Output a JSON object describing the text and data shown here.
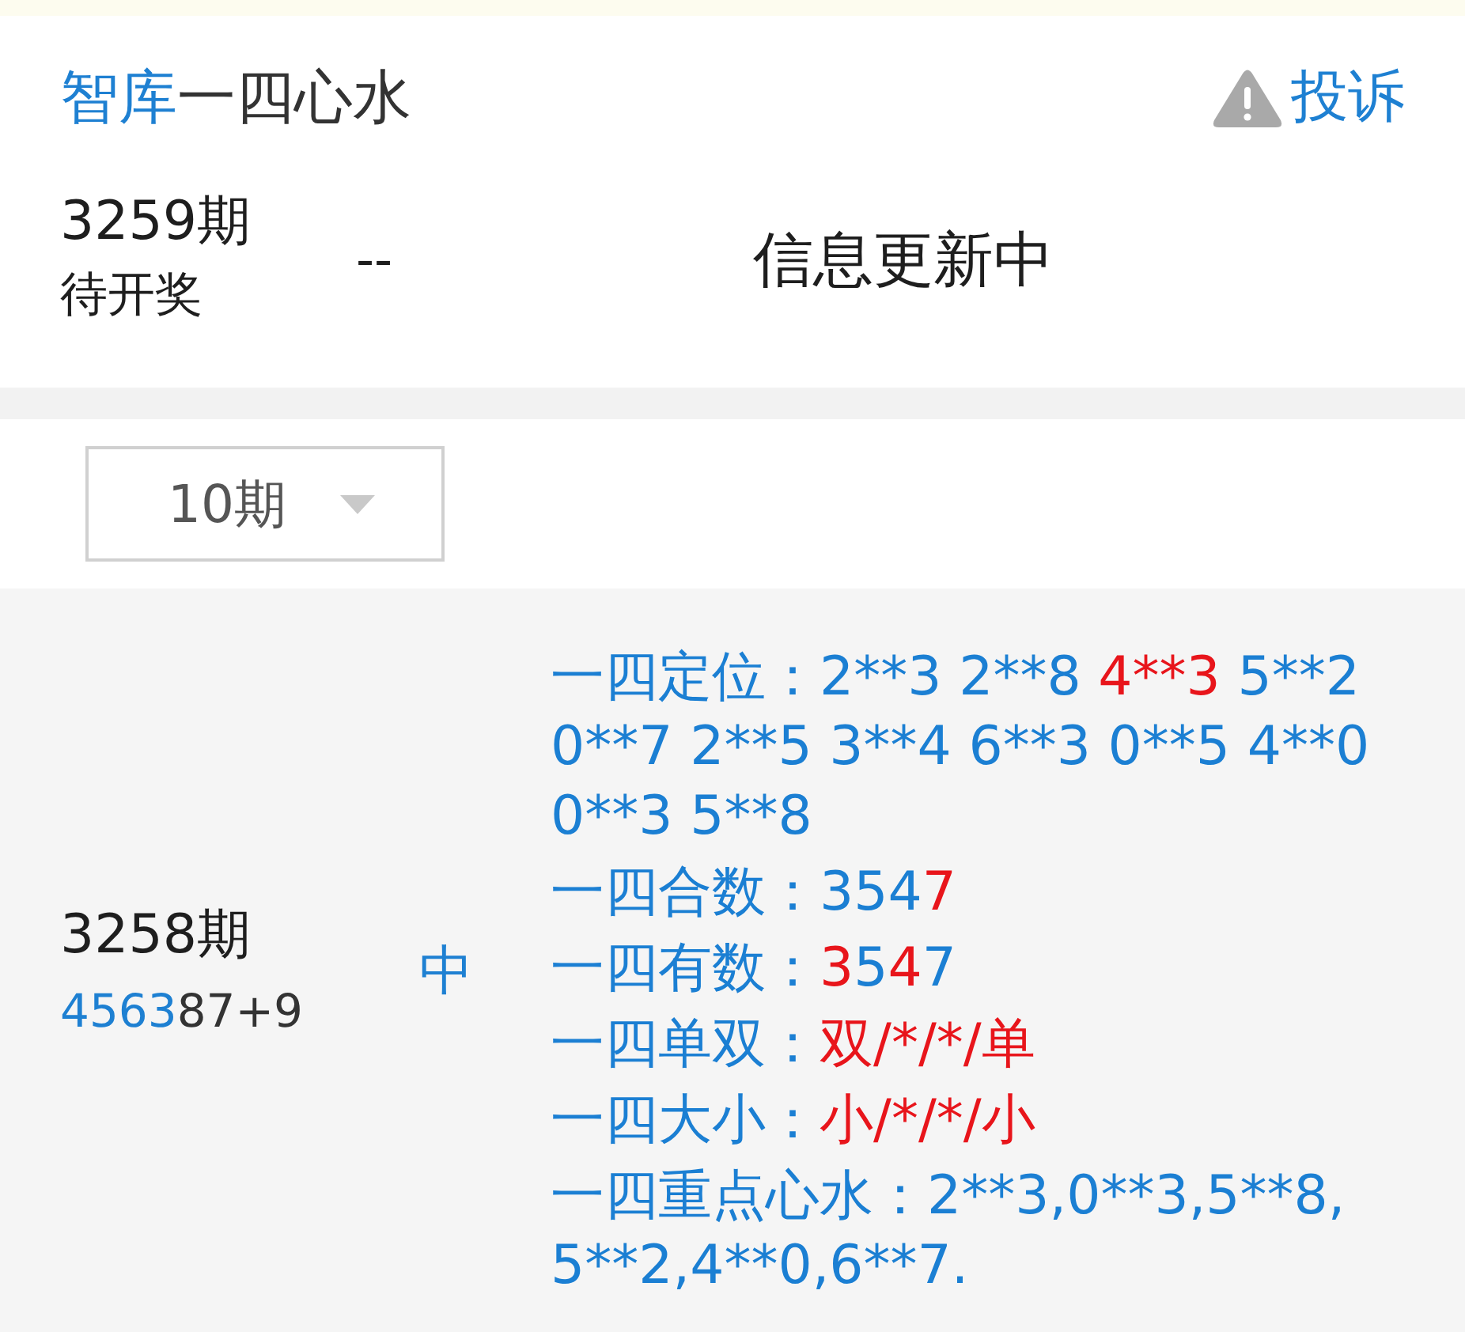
{
  "header": {
    "title": [
      {
        "text": "智库",
        "highlight": true
      },
      {
        "text": "一四心水",
        "highlight": false
      }
    ],
    "complaint": "投诉"
  },
  "current": {
    "period": "3259期",
    "status": "待开奖",
    "numbers": "--",
    "message": "信息更新中"
  },
  "filter": {
    "value": "10期"
  },
  "records": [
    {
      "period": "3258期",
      "result": [
        {
          "text": "4563",
          "highlight": true
        },
        {
          "text": "87+9",
          "highlight": false
        }
      ],
      "verdict": "中",
      "lines": [
        {
          "label": "一四定位：",
          "segments": [
            {
              "text": "2**3 2**8 ",
              "highlight": false
            },
            {
              "text": "4**3",
              "highlight": true
            },
            {
              "text": " 5**2 0**7 2**5 3**4 6**3 0**5 4**0 0**3 5**8",
              "highlight": false
            }
          ]
        },
        {
          "label": "一四合数：",
          "segments": [
            {
              "text": "354",
              "highlight": false
            },
            {
              "text": "7",
              "highlight": true
            }
          ]
        },
        {
          "label": "一四有数：",
          "segments": [
            {
              "text": "3",
              "highlight": true
            },
            {
              "text": "5",
              "highlight": false
            },
            {
              "text": "4",
              "highlight": true
            },
            {
              "text": "7",
              "highlight": false
            }
          ]
        },
        {
          "label": "一四单双：",
          "segments": [
            {
              "text": "双/*/*/单",
              "highlight": true
            }
          ]
        },
        {
          "label": "一四大小：",
          "segments": [
            {
              "text": "小/*/*/小",
              "highlight": true
            }
          ]
        },
        {
          "label": "一四重点心水：",
          "segments": [
            {
              "text": "2**3,0**3,5**8,5**2,4**0,6**7.",
              "highlight": false
            }
          ]
        }
      ]
    }
  ]
}
